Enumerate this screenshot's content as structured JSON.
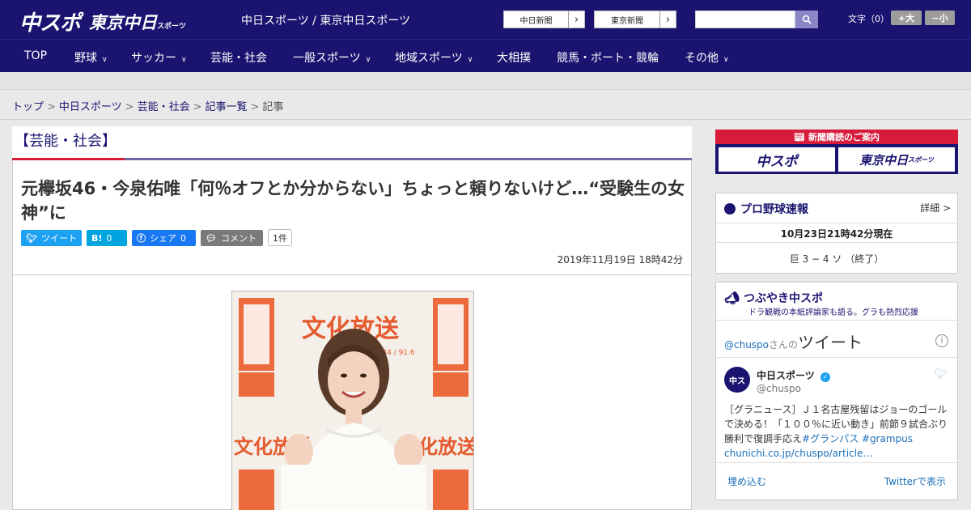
{
  "header": {
    "logo_chuspo": "中スポ",
    "logo_tokyo": "東京中日",
    "logo_tokyo_small": "スポーツ",
    "site_title": "中日スポーツ / 東京中日スポーツ",
    "link_chunichi": "中日新聞",
    "link_tokyo": "東京新聞",
    "search_placeholder": "",
    "fontsize_label": "文字（0）",
    "fontsize_up": "+大",
    "fontsize_down": "−小"
  },
  "nav": {
    "items": [
      "TOP",
      "野球",
      "サッカー",
      "芸能・社会",
      "一般スポーツ",
      "地域スポーツ",
      "大相撲",
      "競馬・ボート・競輪",
      "その他"
    ]
  },
  "breadcrumb": {
    "items": [
      "トップ",
      "中日スポーツ",
      "芸能・社会",
      "記事一覧"
    ],
    "current": "記事"
  },
  "article": {
    "category": "【芸能・社会】",
    "headline": "元欅坂46・今泉佑唯「何％オフとか分からない」ちょっと頼りないけど…“受験生の女神”に",
    "tweet_label": "ツイート",
    "hatena_label": "B!",
    "hatena_count": "0",
    "facebook_label": "シェア",
    "facebook_count": "0",
    "comment_label": "コメント",
    "comment_count": "1件",
    "date": "2019年11月19日 18時42分",
    "photo_sign_1": "文化放送",
    "photo_sign_2": "AM1134 / 91.6"
  },
  "sidebar": {
    "subscribe_header": "新聞購読のご案内",
    "subscribe_chuspo": "中スポ",
    "subscribe_tokyo": "東京中日",
    "subscribe_tokyo_small": "スポーツ",
    "baseball_title": "プロ野球速報",
    "baseball_more": "詳細 >",
    "baseball_time": "10月23日21時42分現在",
    "baseball_score": "巨 3 − 4 ソ （終了）",
    "tsubuyaki_title": "つぶやき中スポ",
    "tsubuyaki_sub": "ドラ観戦の本紙評論家も語る。グラも熱烈応援",
    "tweets_handle": "@chuspo",
    "tweets_suffix": "さんの",
    "tweets_title": "ツイート",
    "tweet_user": "中日スポーツ",
    "tweet_handle": "@chuspo",
    "tweet_body": "［グラニュース］Ｊ１名古屋残留はジョーのゴールで決める！「１００％に近い動き」前節９試合ぶり勝利で復調手応え",
    "tweet_tags": "#グランパス #grampus",
    "tweet_link": "chunichi.co.jp/chuspo/article…",
    "embed_label": "埋め込む",
    "view_on_twitter": "Twitterで表示"
  },
  "colors": {
    "brand_navy": "#1a1470",
    "accent_red": "#d81a3b",
    "twitter_blue": "#1da1f2",
    "hatena_blue": "#00a4de",
    "facebook_blue": "#1877f2",
    "photo_orange": "#ec6a3c"
  }
}
